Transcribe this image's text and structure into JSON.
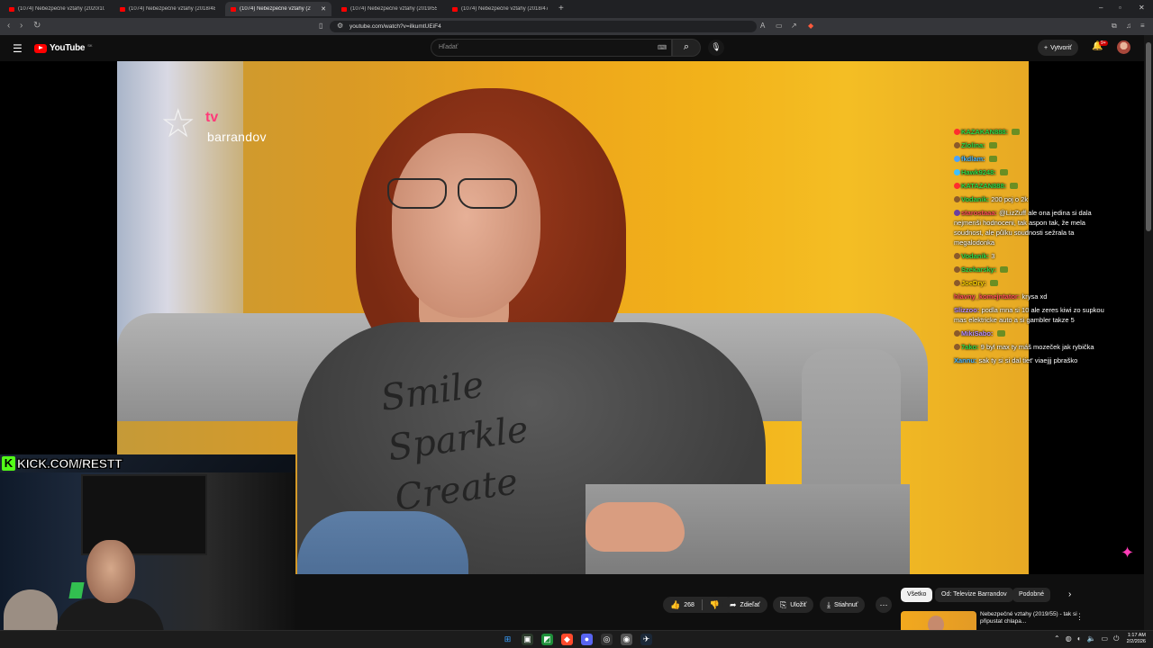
{
  "browser": {
    "tabs": [
      {
        "title": "(1074) Nebezpečné vztahy (2020/10"
      },
      {
        "title": "(1074) Nebezpečné vztahy (2018/48"
      },
      {
        "title": "(1074) Nebezpečné vztahy (2",
        "active": true
      },
      {
        "title": "(1074) Nebezpečné vztahy (2019/55"
      },
      {
        "title": "(1074) Nebezpečné vztahy (2018/47"
      }
    ],
    "url": "youtube.com/watch?v=ilkumtUEiF4"
  },
  "youtube": {
    "logo_text": "YouTube",
    "country_code": "SK",
    "search_placeholder": "Hľadať",
    "create_label": "Vytvoriť",
    "notifications_badge": "9+"
  },
  "video": {
    "channel_logo_tv": "tv",
    "channel_logo_name": "barrandov",
    "shirt_text": "Smile Sparkle Create"
  },
  "chat": [
    {
      "user": "KAZAKAN888:",
      "color": "#2bd94a",
      "msg": ""
    },
    {
      "user": "Zlolina:",
      "color": "#2bd94a",
      "msg": ""
    },
    {
      "user": "fkdlam:",
      "color": "#49b6ff",
      "msg": ""
    },
    {
      "user": "Hawk9248:",
      "color": "#2bd94a",
      "msg": ""
    },
    {
      "user": "KATAZAN888:",
      "color": "#2bd94a",
      "msg": ""
    },
    {
      "user": "Vodanik:",
      "color": "#2bd94a",
      "msg": "200 poj o 2k"
    },
    {
      "user": "starostaaa:",
      "color": "#ff4d5a",
      "msg": "@LizZuff ale ona jedina si dala nejmenši hodnoceni, tak aspon tak, že mela soudnost, ale půlku soudnosti sežrala ta megalodonka"
    },
    {
      "user": "Vodanik:",
      "color": "#2bd94a",
      "msg": "3"
    },
    {
      "user": "Szekarsky:",
      "color": "#2bd94a",
      "msg": ""
    },
    {
      "user": "JoeDry:",
      "color": "#ffd400",
      "msg": ""
    },
    {
      "user": "hlavny_komejntator:",
      "color": "#ff4d5a",
      "msg": "krysa xd"
    },
    {
      "user": "Slizzoo:",
      "color": "#b58cff",
      "msg": "podla mna si 10 ale zeres kiwi zo supkou mas elektricke auto a si gambler takze 5"
    },
    {
      "user": "MikiSabo:",
      "color": "#b58cff",
      "msg": ""
    },
    {
      "user": "7ako:",
      "color": "#2bd94a",
      "msg": "9 byl max ty máš mozeček jak rybička"
    },
    {
      "user": "Xannu:",
      "color": "#49b6ff",
      "msg": "sak ty si si dal tiet' viaejjj pbraško"
    }
  ],
  "overlay": {
    "kick_letter": "K",
    "kick_text": "KICK.COM/RESTT"
  },
  "actions": {
    "likes": "268",
    "share": "Zdieľať",
    "save": "Uložiť",
    "download": "Stiahnuť"
  },
  "chips": [
    "Všetko",
    "Od: Televize Barrandov",
    "Podobné"
  ],
  "recommendation": {
    "title": "Nebezpečné vztahy (2019/55) - tak si připustat chlapa..."
  },
  "taskbar": {
    "time": "1:17 AM",
    "date": "2/2/2026"
  }
}
